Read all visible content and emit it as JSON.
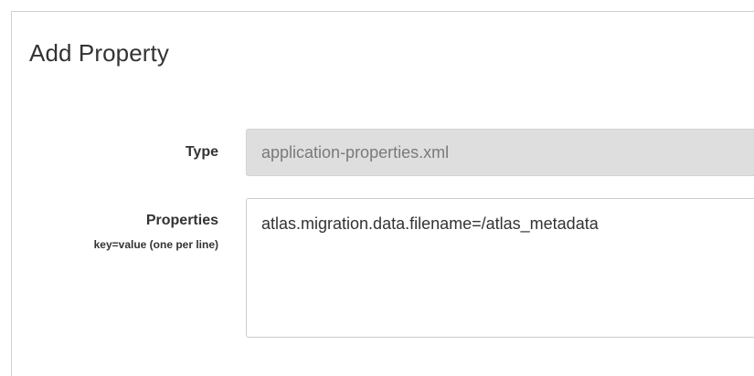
{
  "dialog": {
    "title": "Add Property",
    "type_field": {
      "label": "Type",
      "value": "application-properties.xml"
    },
    "properties_field": {
      "label": "Properties",
      "hint": "key=value (one per line)",
      "value": "atlas.migration.data.filename=/atlas_metadata"
    }
  }
}
